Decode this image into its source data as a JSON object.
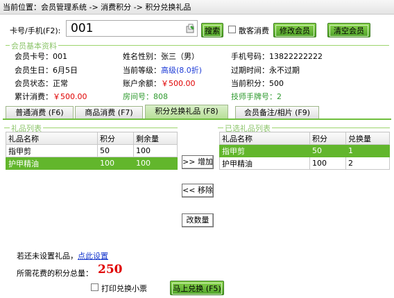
{
  "breadcrumb": "当前位置：会员管理系统 -> 消费积分 -> 积分兑换礼品",
  "card": {
    "label": "卡号/手机(F2):",
    "value": "001",
    "icon": "document-edit-icon"
  },
  "buttons": {
    "search": "搜索",
    "walk_in": "散客消费",
    "edit_member": "修改会员",
    "clear_member": "清空会员"
  },
  "info_section": {
    "legend": "会员基本资料",
    "card_no_label": "会员卡号：",
    "card_no": "001",
    "name_label": "姓名性别：",
    "name": "张三（男）",
    "phone_label": "手机号码：",
    "phone": "13822222222",
    "birthday_label": "会员生日：",
    "birthday": "6月5日",
    "level_label": "当前等级：",
    "level": "高级(8.0折)",
    "expire_label": "过期时间：",
    "expire": "永不过期",
    "status_label": "会员状态：",
    "status": "正常",
    "balance_label": "账户余额：",
    "balance": "￥500.00",
    "points_label": "当前积分：",
    "points": "500",
    "total_label": "累计消费：",
    "total": "￥500.00",
    "room_label": "房间号：",
    "room": "808",
    "tech_label": "技师手牌号：",
    "tech": "2"
  },
  "tabs": [
    {
      "label": "普通消费 (F6)"
    },
    {
      "label": "商品消费 (F7)"
    },
    {
      "label": "积分兑换礼品 (F8)"
    },
    {
      "label": "会员备注/相片 (F9)"
    }
  ],
  "gift_list": {
    "legend": "礼品列表",
    "headers": [
      "礼品名称",
      "积分",
      "剩余量"
    ],
    "rows": [
      {
        "name": "指甲剪",
        "points": "50",
        "remain": "100"
      },
      {
        "name": "护甲精油",
        "points": "100",
        "remain": "100"
      }
    ]
  },
  "selected_list": {
    "legend": "已选礼品列表",
    "headers": [
      "礼品名称",
      "积分",
      "兑换量"
    ],
    "rows": [
      {
        "name": "指甲剪",
        "points": "50",
        "qty": "1"
      },
      {
        "name": "护甲精油",
        "points": "100",
        "qty": "2"
      }
    ]
  },
  "middle_buttons": {
    "add": ">> 增加",
    "remove": "<< 移除",
    "change_qty": "改数量"
  },
  "footer": {
    "hint_prefix": "若还未设置礼品，",
    "hint_link": "点此设置",
    "total_label": "所需花费的积分总量：",
    "total_value": "250",
    "print_label": "打印兑换小票",
    "exchange_button": "马上兑换 (F5)"
  },
  "colors": {
    "accent": "#62b62c",
    "price_red": "#e00000",
    "link_blue": "#1133cc"
  }
}
